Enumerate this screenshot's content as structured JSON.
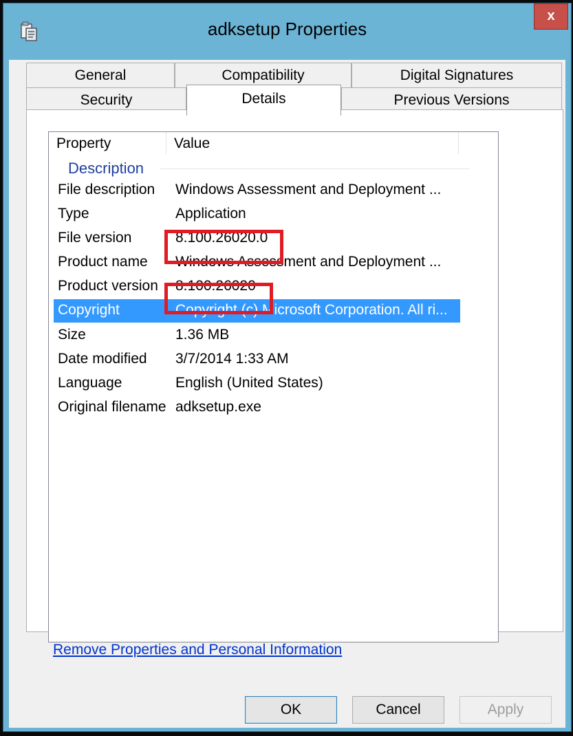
{
  "window": {
    "title": "adksetup Properties",
    "close_glyph": "x",
    "app_icon": "properties-window-icon"
  },
  "tabs": {
    "row1": [
      "General",
      "Compatibility",
      "Digital Signatures"
    ],
    "row2": [
      "Security",
      "Details",
      "Previous Versions"
    ],
    "active": "Details"
  },
  "details": {
    "columns": [
      "Property",
      "Value"
    ],
    "group": "Description",
    "rows": [
      {
        "property": "File description",
        "value": "Windows Assessment and Deployment ..."
      },
      {
        "property": "Type",
        "value": "Application"
      },
      {
        "property": "File version",
        "value": "8.100.26020.0"
      },
      {
        "property": "Product name",
        "value": "Windows Assessment and Deployment ..."
      },
      {
        "property": "Product version",
        "value": "8.100.26020"
      },
      {
        "property": "Copyright",
        "value": "Copyright (c) Microsoft Corporation. All ri..."
      },
      {
        "property": "Size",
        "value": "1.36 MB"
      },
      {
        "property": "Date modified",
        "value": "3/7/2014 1:33 AM"
      },
      {
        "property": "Language",
        "value": "English (United States)"
      },
      {
        "property": "Original filename",
        "value": "adksetup.exe"
      }
    ],
    "selected_row": "Copyright"
  },
  "link": {
    "remove_properties": "Remove Properties and Personal Information"
  },
  "buttons": {
    "ok": "OK",
    "cancel": "Cancel",
    "apply": "Apply"
  },
  "colors": {
    "titlebar": "#6bb4d6",
    "close": "#c7504a",
    "selection": "#3399ff",
    "highlight_box": "#e01b24",
    "link": "#0033cc"
  }
}
